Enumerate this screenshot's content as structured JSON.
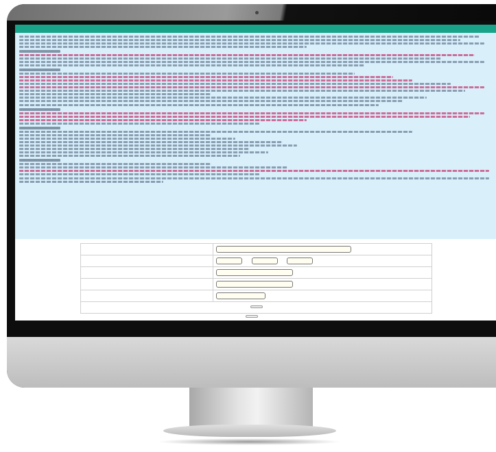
{
  "page": {
    "title": "",
    "notice_heading": "",
    "form": {
      "name_label": "",
      "birthdate_label": "",
      "id_label": "",
      "phone_label": "",
      "captcha_label": "",
      "captcha_code": "",
      "submit_label": "",
      "second_button_label": ""
    }
  }
}
